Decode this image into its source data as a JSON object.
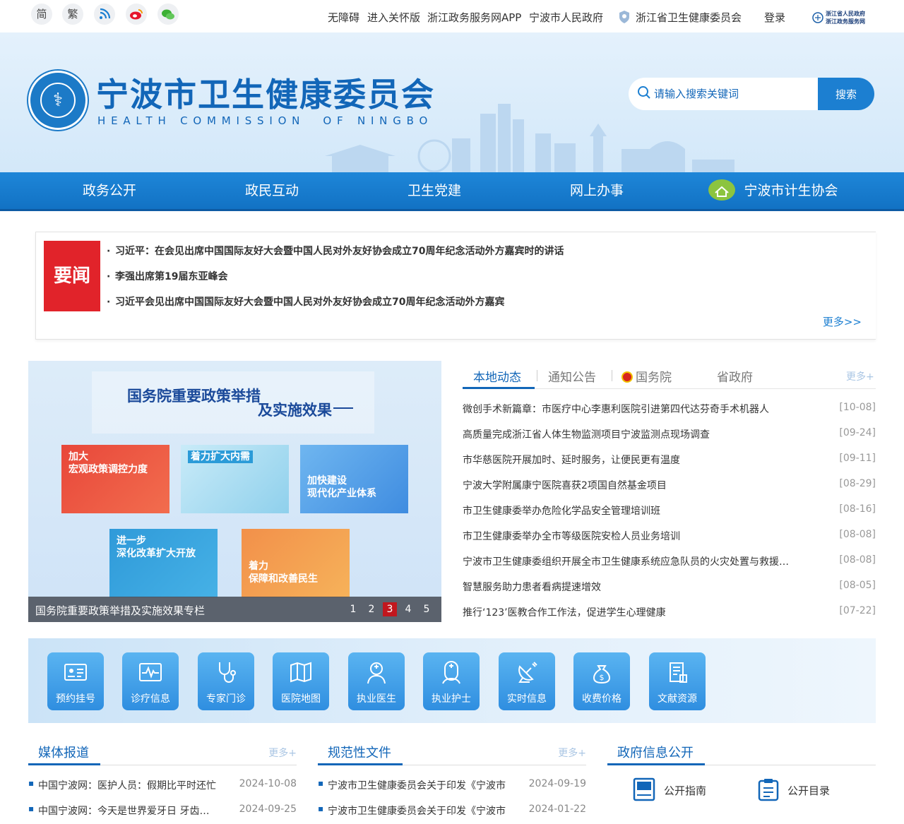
{
  "topbar": {
    "simplified": "简",
    "traditional": "繁",
    "links": [
      "无障碍",
      "进入关怀版",
      "浙江政务服务网APP",
      "宁波市人民政府",
      "浙江省卫生健康委员会",
      "登录"
    ],
    "zj_logo_line1": "浙江省人民政府",
    "zj_logo_line2": "浙江政务服务网"
  },
  "header": {
    "title": "宁波市卫生健康委员会",
    "subtitle": "HEALTH COMMISSION  OF NINGBO",
    "search_placeholder": "请输入搜索关键词",
    "search_button": "搜索"
  },
  "nav": [
    "政务公开",
    "政民互动",
    "卫生党建",
    "网上办事",
    "宁波市计生协会"
  ],
  "headlines": {
    "badge": "要闻",
    "items": [
      "习近平：在会见出席中国国际友好大会暨中国人民对外友好协会成立70周年纪念活动外方嘉宾时的讲话",
      "李强出席第19届东亚峰会",
      "习近平会见出席中国国际友好大会暨中国人民对外友好协会成立70周年纪念活动外方嘉宾"
    ],
    "more": "更多>>"
  },
  "slider": {
    "heading_line1": "国务院重要政策举措",
    "heading_line2": "及实施效果",
    "cards": [
      {
        "l1": "加大",
        "l2": "宏观政策调控力度",
        "color": "#e8473a"
      },
      {
        "l1": "着力扩大内需",
        "l2": "",
        "color": "#8fd0ec"
      },
      {
        "l1": "加快建设",
        "l2": "现代化产业体系",
        "color": "#4f9ee8"
      },
      {
        "l1": "进一步",
        "l2": "深化改革扩大开放",
        "color": "#2f9ad9"
      },
      {
        "l1": "着力",
        "l2": "保障和改善民生",
        "color": "#f2904a"
      }
    ],
    "caption": "国务院重要政策举措及实施效果专栏",
    "pages": [
      "1",
      "2",
      "3",
      "4",
      "5"
    ],
    "active_page": "3"
  },
  "news_tabs": {
    "tabs": [
      "本地动态",
      "通知公告",
      "国务院",
      "省政府"
    ],
    "more": "更多+",
    "items": [
      {
        "title": "微创手术新篇章：市医疗中心李惠利医院引进第四代达芬奇手术机器人",
        "date": "[10-08]"
      },
      {
        "title": "高质量完成浙江省人体生物监测项目宁波监测点现场调查",
        "date": "[09-24]"
      },
      {
        "title": "市华慈医院开展加时、延时服务，让便民更有温度",
        "date": "[09-11]"
      },
      {
        "title": "宁波大学附属康宁医院喜获2项国自然基金项目",
        "date": "[08-29]"
      },
      {
        "title": "市卫生健康委举办危险化学品安全管理培训班",
        "date": "[08-16]"
      },
      {
        "title": "市卫生健康委举办全市等级医院安检人员业务培训",
        "date": "[08-08]"
      },
      {
        "title": "宁波市卫生健康委组织开展全市卫生健康系统应急队员的火灾处置与救援演练",
        "date": "[08-08]"
      },
      {
        "title": "智慧服务助力患者看病提速增效",
        "date": "[08-05]"
      },
      {
        "title": "推行‘123’医教合作工作法，促进学生心理健康",
        "date": "[07-22]"
      }
    ]
  },
  "services": [
    "预约挂号",
    "诊疗信息",
    "专家门诊",
    "医院地图",
    "执业医生",
    "执业护士",
    "实时信息",
    "收费价格",
    "文献资源"
  ],
  "media": {
    "title": "媒体报道",
    "more": "更多+",
    "items": [
      {
        "title": "中国宁波网：医护人员：假期比平时还忙",
        "date": "2024-10-08"
      },
      {
        "title": "中国宁波网：今天是世界爱牙日 牙齿健康",
        "date": "2024-09-25"
      }
    ]
  },
  "docs": {
    "title": "规范性文件",
    "more": "更多+",
    "items": [
      {
        "title": "宁波市卫生健康委员会关于印发《宁波市",
        "date": "2024-09-19"
      },
      {
        "title": "宁波市卫生健康委员会关于印发《宁波市",
        "date": "2024-01-22"
      }
    ]
  },
  "gov_info": {
    "title": "政府信息公开",
    "items": [
      "公开指南",
      "公开目录"
    ]
  },
  "colors": {
    "brand": "#1266b8",
    "nav": "#1e86d8",
    "badge_red": "#e1232a"
  }
}
